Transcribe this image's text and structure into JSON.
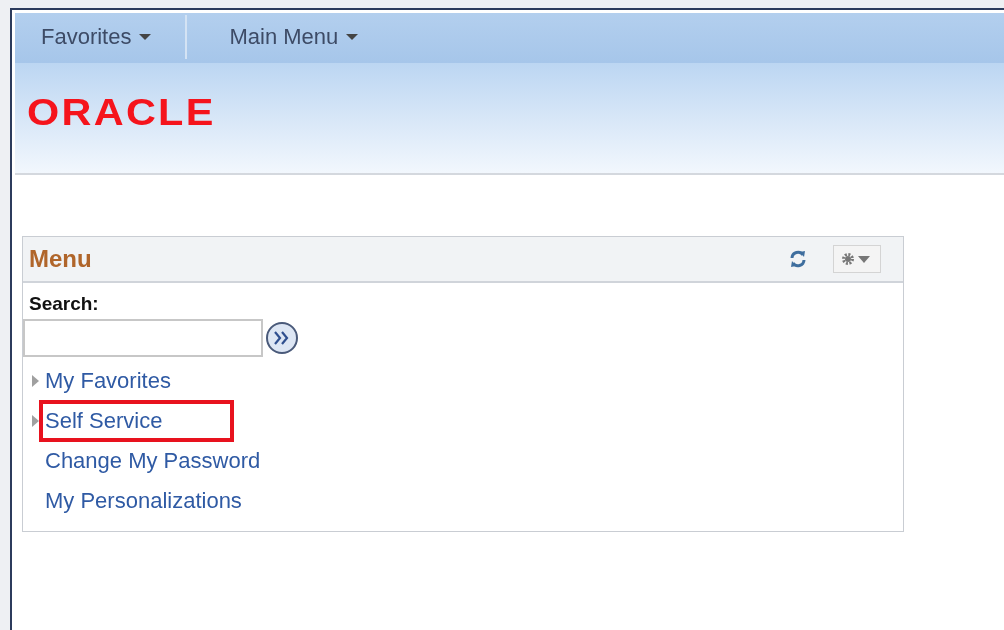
{
  "nav_bar": {
    "items": [
      {
        "label": "Favorites"
      },
      {
        "label": "Main Menu"
      }
    ]
  },
  "header": {
    "logo": "ORACLE"
  },
  "menu_pagelet": {
    "title": "Menu",
    "search": {
      "label": "Search:"
    },
    "items": [
      {
        "label": "My Favorites",
        "kind": "folder",
        "highlighted": false
      },
      {
        "label": "Self Service",
        "kind": "folder",
        "highlighted": true
      },
      {
        "label": "Change My Password",
        "kind": "link",
        "highlighted": false
      },
      {
        "label": "My Personalizations",
        "kind": "link",
        "highlighted": false
      }
    ]
  }
}
